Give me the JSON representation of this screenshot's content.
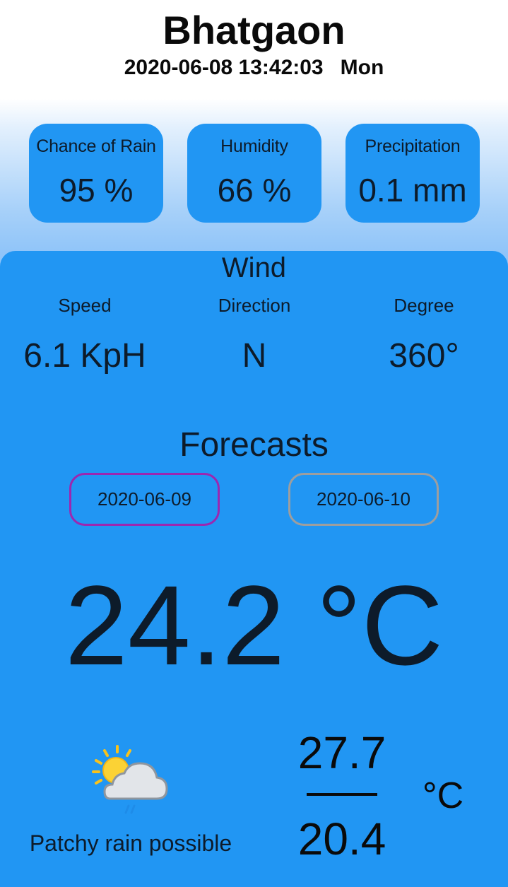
{
  "location": {
    "city": "Bhatgaon",
    "datetime": "2020-06-08 13:42:03",
    "weekday": "Mon"
  },
  "stats": [
    {
      "label": "Chance of Rain",
      "value": "95 %"
    },
    {
      "label": "Humidity",
      "value": "66 %"
    },
    {
      "label": "Precipitation",
      "value": "0.1 mm"
    }
  ],
  "wind": {
    "title": "Wind",
    "speed_label": "Speed",
    "speed_value": "6.1 KpH",
    "direction_label": "Direction",
    "direction_value": "N",
    "degree_label": "Degree",
    "degree_value": "360°"
  },
  "forecasts": {
    "title": "Forecasts",
    "dates": [
      "2020-06-09",
      "2020-06-10"
    ],
    "selected_index": 0,
    "current_temp": "24.2 °C",
    "condition": "Patchy rain possible",
    "condition_icon": "partly-cloudy-light-rain-icon",
    "max_temp": "27.7",
    "min_temp": "20.4",
    "unit": "°C"
  },
  "colors": {
    "accent_blue": "#2196f3",
    "selected_border": "#9c27b0",
    "unselected_border": "#9e9e9e",
    "text_dark": "#0d1b2a"
  }
}
